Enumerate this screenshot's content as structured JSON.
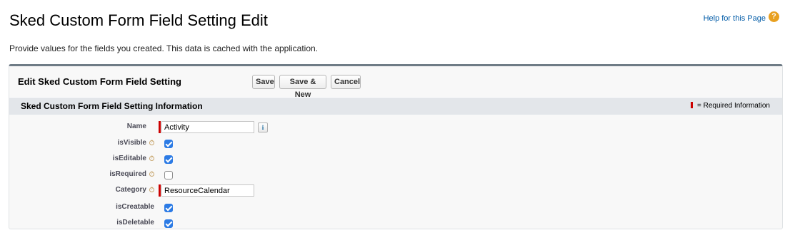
{
  "header": {
    "title": "Sked Custom Form Field Setting Edit",
    "help_link": "Help for this Page",
    "help_icon": "help-question-icon",
    "description": "Provide values for the fields you created. This data is cached with the application."
  },
  "panel": {
    "title": "Edit Sked Custom Form Field Setting",
    "buttons": {
      "save": "Save",
      "save_new": "Save & New",
      "cancel": "Cancel"
    },
    "section": {
      "title": "Sked Custom Form Field Setting Information",
      "required_legend": "= Required Information"
    },
    "fields": {
      "name": {
        "label": "Name",
        "value": "Activity",
        "required": true,
        "lookup_button": "i"
      },
      "is_visible": {
        "label": "isVisible",
        "checked": true
      },
      "is_editable": {
        "label": "isEditable",
        "checked": true
      },
      "is_required": {
        "label": "isRequired",
        "checked": false
      },
      "category": {
        "label": "Category",
        "value": "ResourceCalendar",
        "required": true
      },
      "is_creatable": {
        "label": "isCreatable",
        "checked": true
      },
      "is_deletable": {
        "label": "isDeletable",
        "checked": true
      }
    }
  },
  "colors": {
    "link": "#015ba7",
    "required": "#cc0000",
    "checkbox": "#2c7be5",
    "section_bar": "#e3e6ea",
    "panel_top_border": "#6f7c86"
  }
}
